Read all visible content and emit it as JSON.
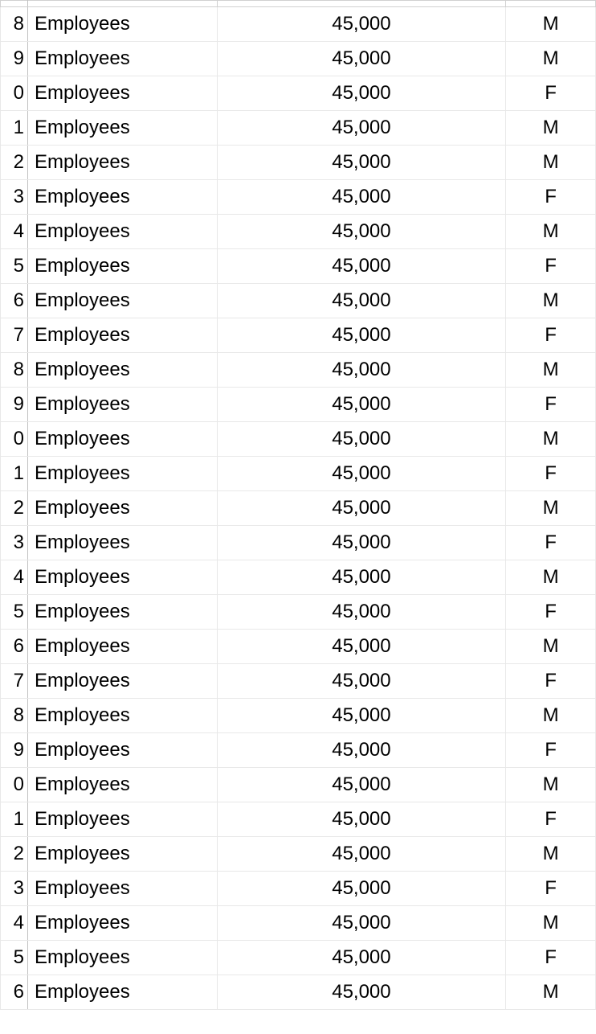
{
  "rows": [
    {
      "num": "8",
      "category": "Employees",
      "salary": "45,000",
      "gender": "M"
    },
    {
      "num": "9",
      "category": "Employees",
      "salary": "45,000",
      "gender": "M"
    },
    {
      "num": "0",
      "category": "Employees",
      "salary": "45,000",
      "gender": "F"
    },
    {
      "num": "1",
      "category": "Employees",
      "salary": "45,000",
      "gender": "M"
    },
    {
      "num": "2",
      "category": "Employees",
      "salary": "45,000",
      "gender": "M"
    },
    {
      "num": "3",
      "category": "Employees",
      "salary": "45,000",
      "gender": "F"
    },
    {
      "num": "4",
      "category": "Employees",
      "salary": "45,000",
      "gender": "M"
    },
    {
      "num": "5",
      "category": "Employees",
      "salary": "45,000",
      "gender": "F"
    },
    {
      "num": "6",
      "category": "Employees",
      "salary": "45,000",
      "gender": "M"
    },
    {
      "num": "7",
      "category": "Employees",
      "salary": "45,000",
      "gender": "F"
    },
    {
      "num": "8",
      "category": "Employees",
      "salary": "45,000",
      "gender": "M"
    },
    {
      "num": "9",
      "category": "Employees",
      "salary": "45,000",
      "gender": "F"
    },
    {
      "num": "0",
      "category": "Employees",
      "salary": "45,000",
      "gender": "M"
    },
    {
      "num": "1",
      "category": "Employees",
      "salary": "45,000",
      "gender": "F"
    },
    {
      "num": "2",
      "category": "Employees",
      "salary": "45,000",
      "gender": "M"
    },
    {
      "num": "3",
      "category": "Employees",
      "salary": "45,000",
      "gender": "F"
    },
    {
      "num": "4",
      "category": "Employees",
      "salary": "45,000",
      "gender": "M"
    },
    {
      "num": "5",
      "category": "Employees",
      "salary": "45,000",
      "gender": "F"
    },
    {
      "num": "6",
      "category": "Employees",
      "salary": "45,000",
      "gender": "M"
    },
    {
      "num": "7",
      "category": "Employees",
      "salary": "45,000",
      "gender": "F"
    },
    {
      "num": "8",
      "category": "Employees",
      "salary": "45,000",
      "gender": "M"
    },
    {
      "num": "9",
      "category": "Employees",
      "salary": "45,000",
      "gender": "F"
    },
    {
      "num": "0",
      "category": "Employees",
      "salary": "45,000",
      "gender": "M"
    },
    {
      "num": "1",
      "category": "Employees",
      "salary": "45,000",
      "gender": "F"
    },
    {
      "num": "2",
      "category": "Employees",
      "salary": "45,000",
      "gender": "M"
    },
    {
      "num": "3",
      "category": "Employees",
      "salary": "45,000",
      "gender": "F"
    },
    {
      "num": "4",
      "category": "Employees",
      "salary": "45,000",
      "gender": "M"
    },
    {
      "num": "5",
      "category": "Employees",
      "salary": "45,000",
      "gender": "F"
    },
    {
      "num": "6",
      "category": "Employees",
      "salary": "45,000",
      "gender": "M"
    }
  ]
}
